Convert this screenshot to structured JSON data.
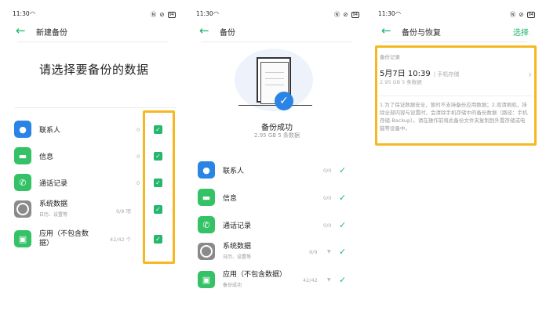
{
  "screens": [
    {
      "status": {
        "time": "11:30",
        "battery": "94"
      },
      "title": "新建备份",
      "heading": "请选择要备份的数据",
      "items": [
        {
          "label": "联系人",
          "count": "0",
          "icon": "contacts-icon",
          "color": "#2a84e6"
        },
        {
          "label": "信息",
          "count": "0",
          "icon": "message-icon",
          "color": "#35c266"
        },
        {
          "label": "通话记录",
          "count": "0",
          "icon": "phone-icon",
          "color": "#35c266"
        },
        {
          "label": "系统数据",
          "sub": "日历、设置等",
          "count": "9/9 项",
          "icon": "system-icon",
          "color": "#8a8a8a"
        },
        {
          "label": "应用（不包含数",
          "label_line2": "据）",
          "count": "42/42 个",
          "icon": "app-icon",
          "color": "#35c266"
        }
      ]
    },
    {
      "status": {
        "time": "11:30",
        "battery": "94"
      },
      "title": "备份",
      "success": "备份成功",
      "success_sub": "2.95 GB  5 条数据",
      "items": [
        {
          "label": "联系人",
          "count": "0/0",
          "icon": "contacts-icon"
        },
        {
          "label": "信息",
          "count": "0/0",
          "icon": "message-icon"
        },
        {
          "label": "通话记录",
          "count": "0/0",
          "icon": "phone-icon"
        },
        {
          "label": "系统数据",
          "sub": "日历、设置等",
          "count": "9/9",
          "icon": "system-icon"
        },
        {
          "label": "应用（不包含数据）",
          "sub": "备份成功",
          "count": "42/42",
          "icon": "app-icon"
        }
      ]
    },
    {
      "status": {
        "time": "11:30",
        "battery": "94"
      },
      "title": "备份与恢复",
      "select": "选择",
      "section": "备份记录",
      "record": {
        "date": "5月7日 10:39",
        "location": "| 手机存储",
        "meta": "2.95 GB  5 条数据"
      },
      "note": "1.为了保证数据安全，暂时不支持备份应用数据；2.双清刷机、抹除全部内容与设置时，会清除手机存储中的备份数据（路径：手机存储-Backup）。请在操作前将此备份文件夹复制到外置存储或电脑等设备中。"
    }
  ],
  "accent": "#25b76b",
  "highlight": "#f6b820"
}
